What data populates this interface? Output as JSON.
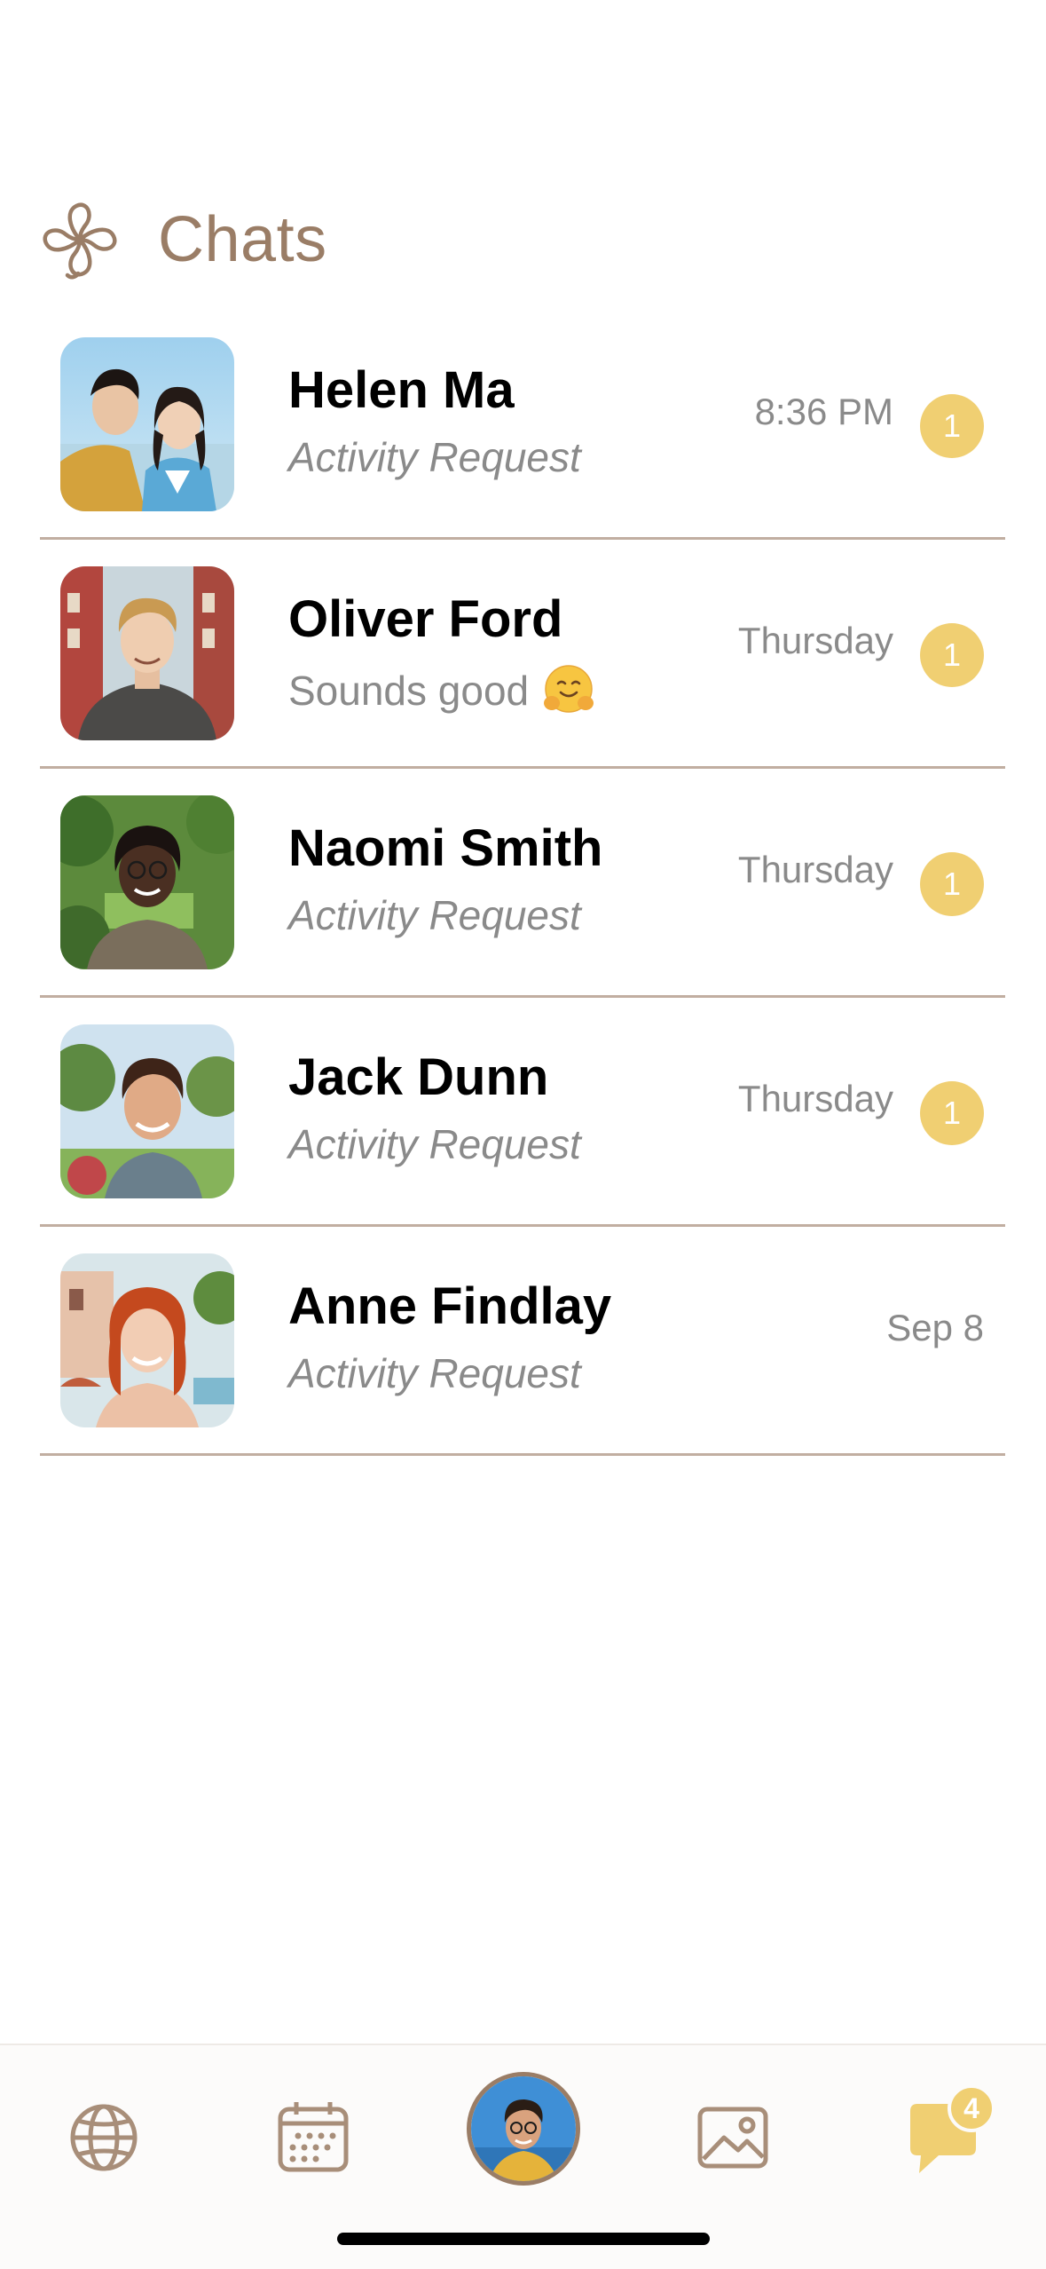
{
  "header": {
    "title": "Chats",
    "logo_icon": "quatrefoil-logo-icon"
  },
  "chats": [
    {
      "name": "Helen Ma",
      "preview": "Activity Request",
      "time": "8:36 PM",
      "unread": "1",
      "avatar": "couple-photo"
    },
    {
      "name": "Oliver Ford",
      "preview": "Sounds good",
      "preview_emoji": "hugging-face-emoji",
      "time": "Thursday",
      "unread": "1",
      "avatar": "blond-man-photo"
    },
    {
      "name": "Naomi Smith",
      "preview": "Activity Request",
      "time": "Thursday",
      "unread": "1",
      "avatar": "woman-glasses-photo"
    },
    {
      "name": "Jack Dunn",
      "preview": "Activity Request",
      "time": "Thursday",
      "unread": "1",
      "avatar": "smiling-man-photo"
    },
    {
      "name": "Anne Findlay",
      "preview": "Activity Request",
      "time": "Sep 8",
      "unread": null,
      "avatar": "red-hair-woman-photo"
    }
  ],
  "tabbar": {
    "items": [
      "globe-icon",
      "calendar-icon",
      "profile-avatar",
      "photos-icon",
      "chat-bubble-icon"
    ],
    "chats_badge": "4"
  },
  "colors": {
    "accent_brown": "#9a7d66",
    "badge_yellow": "#f0cf72",
    "divider": "#c1aea1",
    "secondary_text": "#8a8a8a"
  }
}
